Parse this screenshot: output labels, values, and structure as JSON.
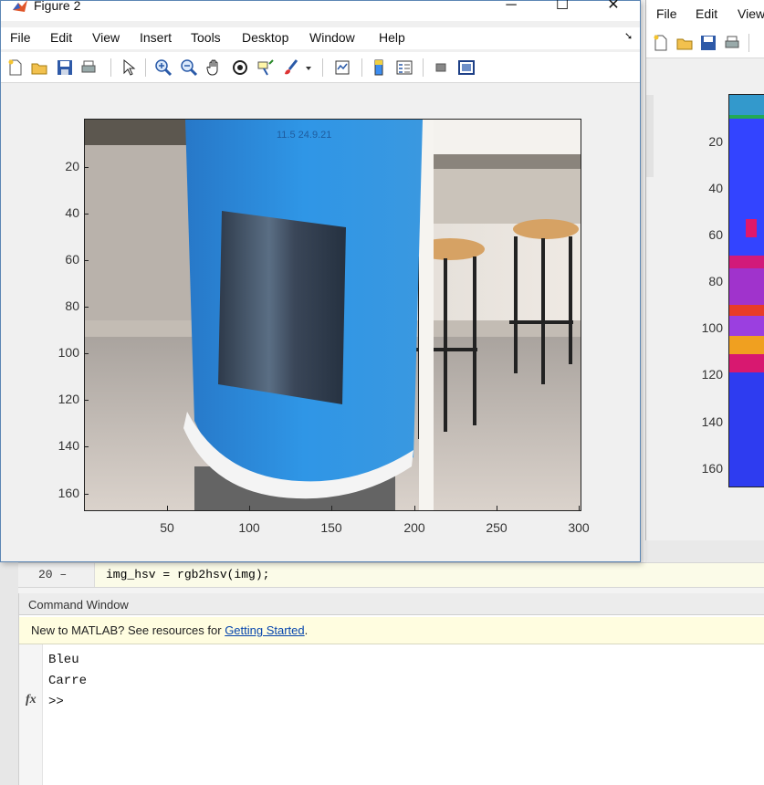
{
  "figure2": {
    "title": "Figure 2",
    "window_buttons": {
      "minimize": "─",
      "maximize": "☐",
      "close": "✕"
    },
    "menu": [
      "File",
      "Edit",
      "View",
      "Insert",
      "Tools",
      "Desktop",
      "Window",
      "Help"
    ],
    "menu_overflow": "➘",
    "toolbar_icons": [
      "new-figure-icon",
      "open-file-icon",
      "save-icon",
      "print-icon",
      "edit-plot-arrow-icon",
      "zoom-in-icon",
      "zoom-out-icon",
      "pan-hand-icon",
      "rotate-3d-icon",
      "data-cursor-icon",
      "brush-icon",
      "brush-dropdown-icon",
      "link-plot-icon",
      "insert-colorbar-icon",
      "insert-legend-icon",
      "hide-plot-tools-icon",
      "show-plot-tools-icon"
    ],
    "axes": {
      "y_ticks": [
        "20",
        "40",
        "60",
        "80",
        "100",
        "120",
        "140",
        "160"
      ],
      "x_ticks": [
        "50",
        "100",
        "150",
        "200",
        "250",
        "300"
      ],
      "image_text": "11.5 24.9.21"
    }
  },
  "figure1": {
    "menu": [
      "File",
      "Edit",
      "View"
    ],
    "toolbar_icons": [
      "new-figure-icon",
      "open-file-icon",
      "save-icon",
      "print-icon"
    ],
    "y_ticks": [
      "20",
      "40",
      "60",
      "80",
      "100",
      "120",
      "140",
      "160"
    ]
  },
  "editor": {
    "line_number": "20",
    "line_marker": "–",
    "code": "img_hsv = rgb2hsv(img);"
  },
  "command_window": {
    "title": "Command Window",
    "banner_text": "New to MATLAB? See resources for ",
    "banner_link": "Getting Started",
    "banner_end": ".",
    "output": [
      "Bleu",
      "Carre"
    ],
    "prompt": ">>",
    "fx_label": "fx"
  },
  "colors": {
    "blue_label": "#2a8fe0",
    "window_border": "#5c86b4",
    "link": "#0645ad"
  }
}
